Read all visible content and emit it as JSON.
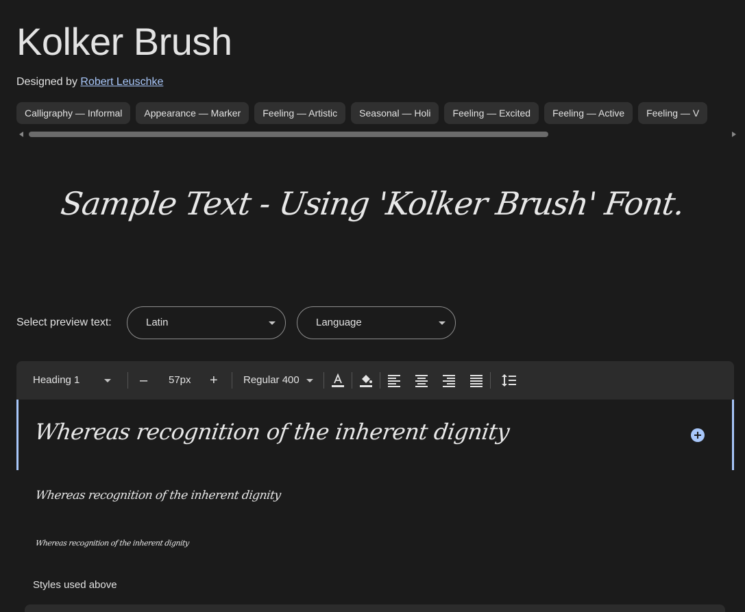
{
  "font": {
    "title": "Kolker Brush",
    "designed_by_label": "Designed by",
    "designer": "Robert Leuschke"
  },
  "tags": [
    "Calligraphy — Informal",
    "Appearance — Marker",
    "Feeling — Artistic",
    "Seasonal — Holi",
    "Feeling — Excited",
    "Feeling — Active",
    "Feeling — V"
  ],
  "hero_sample": "Sample Text - Using 'Kolker Brush' Font.",
  "preview": {
    "label": "Select preview text:",
    "script_select": "Latin",
    "language_select": "Language"
  },
  "toolbar": {
    "style_select": "Heading 1",
    "decrease": "–",
    "size": "57px",
    "increase": "+",
    "weight_select": "Regular 400",
    "icons": [
      "text-color-icon",
      "highlight-color-icon",
      "align-left-icon",
      "align-center-icon",
      "align-right-icon",
      "align-justify-icon",
      "line-height-icon"
    ]
  },
  "samples": [
    "Whereas recognition of the inherent dignity",
    "Whereas recognition of the inherent dignity",
    "Whereas recognition of the inherent dignity"
  ],
  "styles_used_label": "Styles used above",
  "colors": {
    "background": "#1b1b1b",
    "surface": "#2c2c2c",
    "chip": "#303030",
    "accent": "#a8c7fa",
    "text": "#e3e3e3"
  }
}
